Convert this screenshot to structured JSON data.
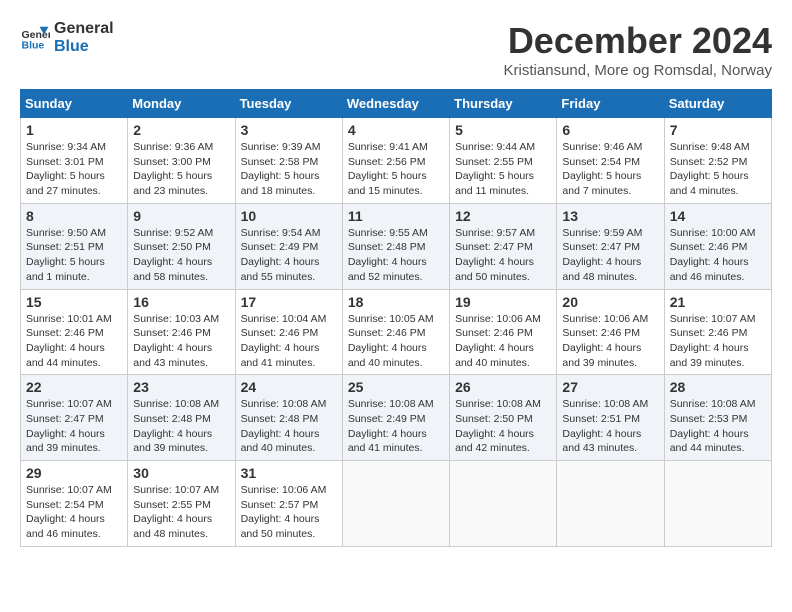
{
  "header": {
    "logo_line1": "General",
    "logo_line2": "Blue",
    "title": "December 2024",
    "location": "Kristiansund, More og Romsdal, Norway"
  },
  "weekdays": [
    "Sunday",
    "Monday",
    "Tuesday",
    "Wednesday",
    "Thursday",
    "Friday",
    "Saturday"
  ],
  "weeks": [
    [
      {
        "day": "1",
        "sunrise": "9:34 AM",
        "sunset": "3:01 PM",
        "daylight": "5 hours and 27 minutes."
      },
      {
        "day": "2",
        "sunrise": "9:36 AM",
        "sunset": "3:00 PM",
        "daylight": "5 hours and 23 minutes."
      },
      {
        "day": "3",
        "sunrise": "9:39 AM",
        "sunset": "2:58 PM",
        "daylight": "5 hours and 18 minutes."
      },
      {
        "day": "4",
        "sunrise": "9:41 AM",
        "sunset": "2:56 PM",
        "daylight": "5 hours and 15 minutes."
      },
      {
        "day": "5",
        "sunrise": "9:44 AM",
        "sunset": "2:55 PM",
        "daylight": "5 hours and 11 minutes."
      },
      {
        "day": "6",
        "sunrise": "9:46 AM",
        "sunset": "2:54 PM",
        "daylight": "5 hours and 7 minutes."
      },
      {
        "day": "7",
        "sunrise": "9:48 AM",
        "sunset": "2:52 PM",
        "daylight": "5 hours and 4 minutes."
      }
    ],
    [
      {
        "day": "8",
        "sunrise": "9:50 AM",
        "sunset": "2:51 PM",
        "daylight": "5 hours and 1 minute."
      },
      {
        "day": "9",
        "sunrise": "9:52 AM",
        "sunset": "2:50 PM",
        "daylight": "4 hours and 58 minutes."
      },
      {
        "day": "10",
        "sunrise": "9:54 AM",
        "sunset": "2:49 PM",
        "daylight": "4 hours and 55 minutes."
      },
      {
        "day": "11",
        "sunrise": "9:55 AM",
        "sunset": "2:48 PM",
        "daylight": "4 hours and 52 minutes."
      },
      {
        "day": "12",
        "sunrise": "9:57 AM",
        "sunset": "2:47 PM",
        "daylight": "4 hours and 50 minutes."
      },
      {
        "day": "13",
        "sunrise": "9:59 AM",
        "sunset": "2:47 PM",
        "daylight": "4 hours and 48 minutes."
      },
      {
        "day": "14",
        "sunrise": "10:00 AM",
        "sunset": "2:46 PM",
        "daylight": "4 hours and 46 minutes."
      }
    ],
    [
      {
        "day": "15",
        "sunrise": "10:01 AM",
        "sunset": "2:46 PM",
        "daylight": "4 hours and 44 minutes."
      },
      {
        "day": "16",
        "sunrise": "10:03 AM",
        "sunset": "2:46 PM",
        "daylight": "4 hours and 43 minutes."
      },
      {
        "day": "17",
        "sunrise": "10:04 AM",
        "sunset": "2:46 PM",
        "daylight": "4 hours and 41 minutes."
      },
      {
        "day": "18",
        "sunrise": "10:05 AM",
        "sunset": "2:46 PM",
        "daylight": "4 hours and 40 minutes."
      },
      {
        "day": "19",
        "sunrise": "10:06 AM",
        "sunset": "2:46 PM",
        "daylight": "4 hours and 40 minutes."
      },
      {
        "day": "20",
        "sunrise": "10:06 AM",
        "sunset": "2:46 PM",
        "daylight": "4 hours and 39 minutes."
      },
      {
        "day": "21",
        "sunrise": "10:07 AM",
        "sunset": "2:46 PM",
        "daylight": "4 hours and 39 minutes."
      }
    ],
    [
      {
        "day": "22",
        "sunrise": "10:07 AM",
        "sunset": "2:47 PM",
        "daylight": "4 hours and 39 minutes."
      },
      {
        "day": "23",
        "sunrise": "10:08 AM",
        "sunset": "2:48 PM",
        "daylight": "4 hours and 39 minutes."
      },
      {
        "day": "24",
        "sunrise": "10:08 AM",
        "sunset": "2:48 PM",
        "daylight": "4 hours and 40 minutes."
      },
      {
        "day": "25",
        "sunrise": "10:08 AM",
        "sunset": "2:49 PM",
        "daylight": "4 hours and 41 minutes."
      },
      {
        "day": "26",
        "sunrise": "10:08 AM",
        "sunset": "2:50 PM",
        "daylight": "4 hours and 42 minutes."
      },
      {
        "day": "27",
        "sunrise": "10:08 AM",
        "sunset": "2:51 PM",
        "daylight": "4 hours and 43 minutes."
      },
      {
        "day": "28",
        "sunrise": "10:08 AM",
        "sunset": "2:53 PM",
        "daylight": "4 hours and 44 minutes."
      }
    ],
    [
      {
        "day": "29",
        "sunrise": "10:07 AM",
        "sunset": "2:54 PM",
        "daylight": "4 hours and 46 minutes."
      },
      {
        "day": "30",
        "sunrise": "10:07 AM",
        "sunset": "2:55 PM",
        "daylight": "4 hours and 48 minutes."
      },
      {
        "day": "31",
        "sunrise": "10:06 AM",
        "sunset": "2:57 PM",
        "daylight": "4 hours and 50 minutes."
      },
      null,
      null,
      null,
      null
    ]
  ]
}
